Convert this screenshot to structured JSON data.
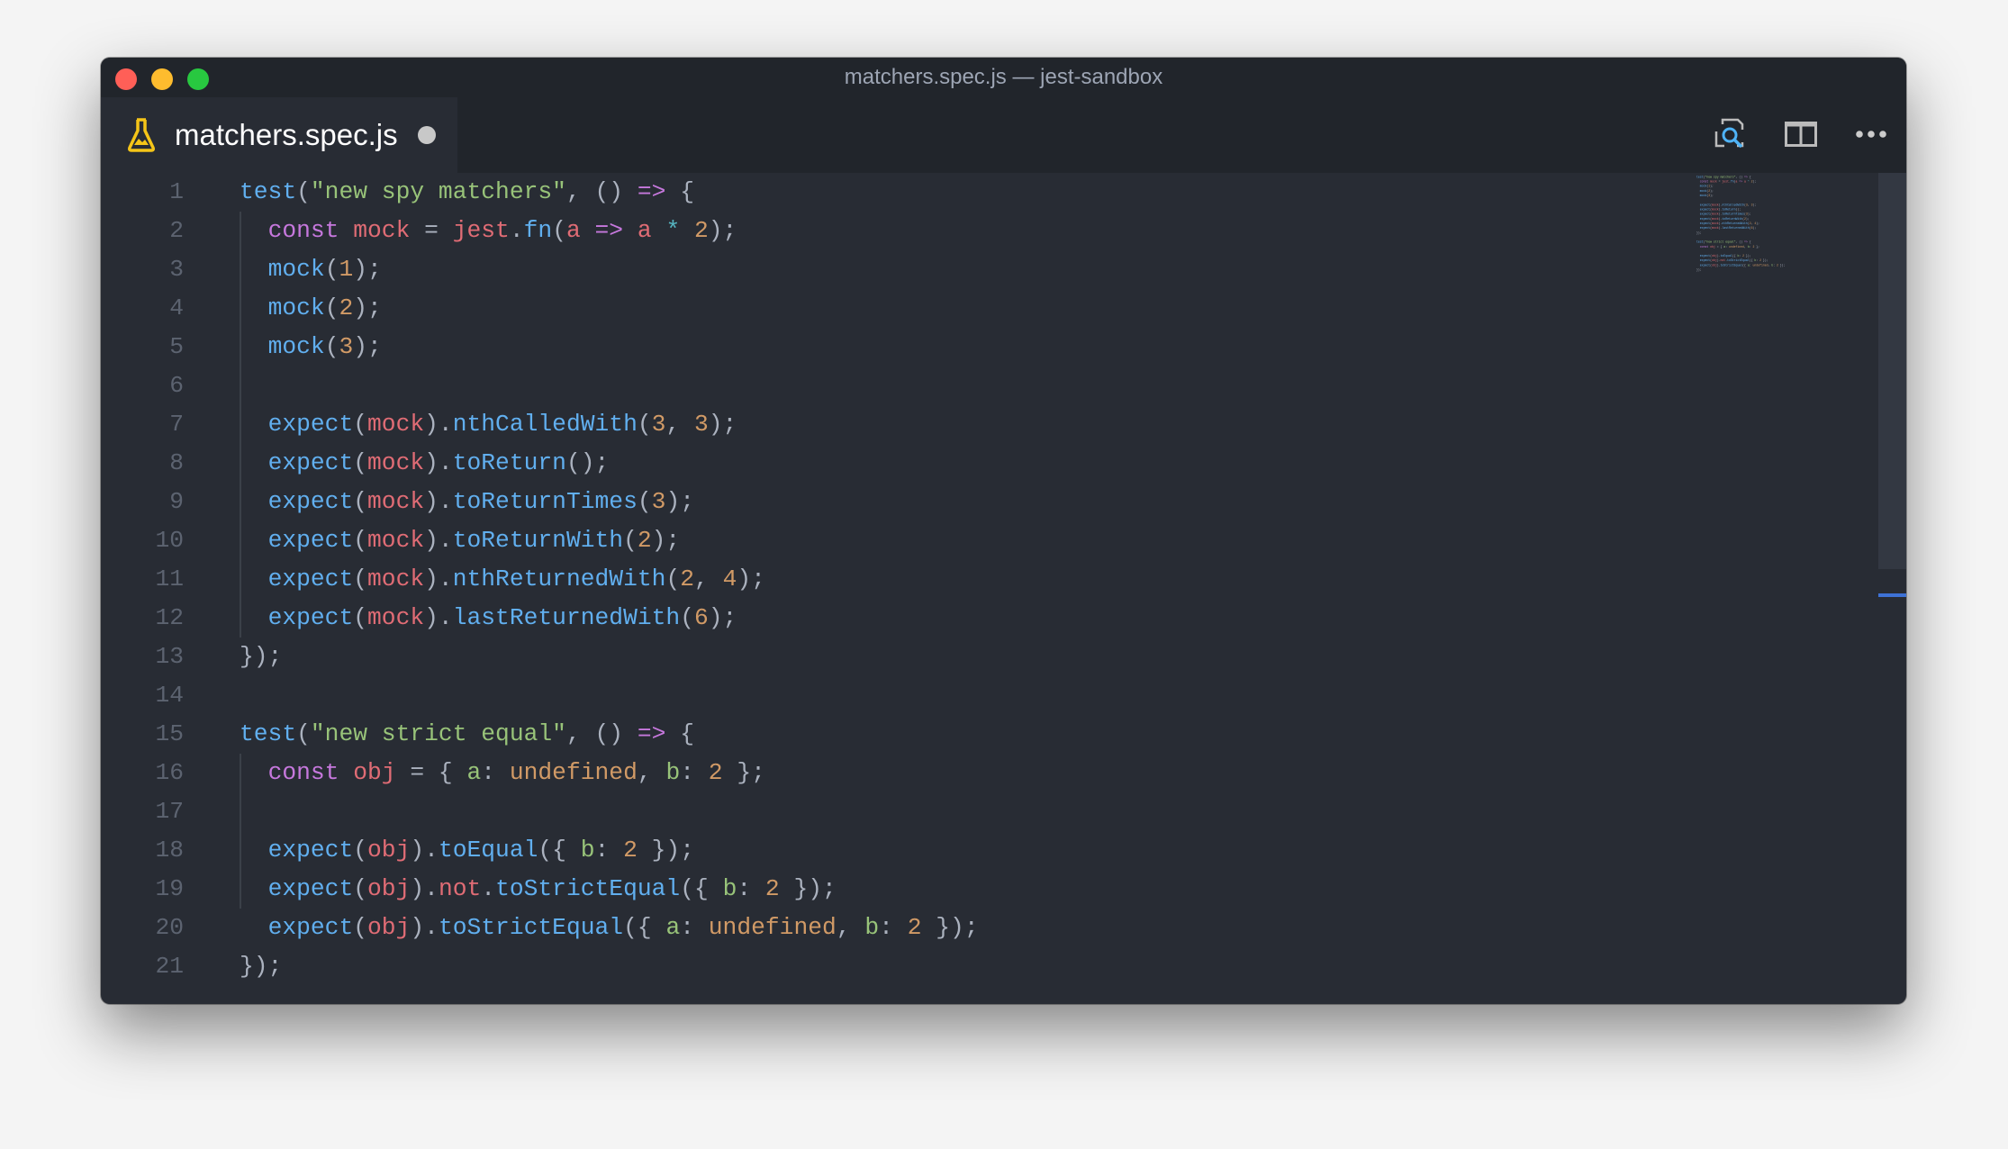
{
  "window": {
    "title": "matchers.spec.js — jest-sandbox",
    "traffic_lights": {
      "close": "#ff5f57",
      "minimize": "#febc2e",
      "zoom": "#28c840"
    }
  },
  "tab": {
    "label": "matchers.spec.js",
    "icon": "flask-icon",
    "icon_color": "#f5c518",
    "modified": true
  },
  "toolbar": {
    "icons": [
      "preview-search-icon",
      "split-editor-icon",
      "more-icon"
    ]
  },
  "theme": {
    "background": "#282c34",
    "keyword": "#c678dd",
    "variable": "#e06c75",
    "function": "#61afef",
    "string": "#98c379",
    "number": "#d19a66",
    "operator": "#56b6c2",
    "accent": "#3e72d6"
  },
  "editor": {
    "lines": [
      {
        "number": "1",
        "indent": 0,
        "tokens": [
          [
            "f",
            "test"
          ],
          [
            "p",
            "("
          ],
          [
            "s",
            "\"new spy matchers\""
          ],
          [
            "p",
            ", () "
          ],
          [
            "k",
            "=>"
          ],
          [
            "p",
            " {"
          ]
        ]
      },
      {
        "number": "2",
        "indent": 1,
        "tokens": [
          [
            "k",
            "const"
          ],
          [
            "p",
            " "
          ],
          [
            "v",
            "mock"
          ],
          [
            "p",
            " = "
          ],
          [
            "v",
            "jest"
          ],
          [
            "p",
            "."
          ],
          [
            "f",
            "fn"
          ],
          [
            "p",
            "("
          ],
          [
            "v",
            "a"
          ],
          [
            "p",
            " "
          ],
          [
            "k",
            "=>"
          ],
          [
            "p",
            " "
          ],
          [
            "v",
            "a"
          ],
          [
            "p",
            " "
          ],
          [
            "o",
            "*"
          ],
          [
            "p",
            " "
          ],
          [
            "n",
            "2"
          ],
          [
            "p",
            ");"
          ]
        ]
      },
      {
        "number": "3",
        "indent": 1,
        "tokens": [
          [
            "f",
            "mock"
          ],
          [
            "p",
            "("
          ],
          [
            "n",
            "1"
          ],
          [
            "p",
            ");"
          ]
        ]
      },
      {
        "number": "4",
        "indent": 1,
        "tokens": [
          [
            "f",
            "mock"
          ],
          [
            "p",
            "("
          ],
          [
            "n",
            "2"
          ],
          [
            "p",
            ");"
          ]
        ]
      },
      {
        "number": "5",
        "indent": 1,
        "tokens": [
          [
            "f",
            "mock"
          ],
          [
            "p",
            "("
          ],
          [
            "n",
            "3"
          ],
          [
            "p",
            ");"
          ]
        ]
      },
      {
        "number": "6",
        "indent": 1,
        "tokens": []
      },
      {
        "number": "7",
        "indent": 1,
        "tokens": [
          [
            "f",
            "expect"
          ],
          [
            "p",
            "("
          ],
          [
            "v",
            "mock"
          ],
          [
            "p",
            ")."
          ],
          [
            "f",
            "nthCalledWith"
          ],
          [
            "p",
            "("
          ],
          [
            "n",
            "3"
          ],
          [
            "p",
            ", "
          ],
          [
            "n",
            "3"
          ],
          [
            "p",
            ");"
          ]
        ]
      },
      {
        "number": "8",
        "indent": 1,
        "tokens": [
          [
            "f",
            "expect"
          ],
          [
            "p",
            "("
          ],
          [
            "v",
            "mock"
          ],
          [
            "p",
            ")."
          ],
          [
            "f",
            "toReturn"
          ],
          [
            "p",
            "();"
          ]
        ]
      },
      {
        "number": "9",
        "indent": 1,
        "tokens": [
          [
            "f",
            "expect"
          ],
          [
            "p",
            "("
          ],
          [
            "v",
            "mock"
          ],
          [
            "p",
            ")."
          ],
          [
            "f",
            "toReturnTimes"
          ],
          [
            "p",
            "("
          ],
          [
            "n",
            "3"
          ],
          [
            "p",
            ");"
          ]
        ]
      },
      {
        "number": "10",
        "indent": 1,
        "tokens": [
          [
            "f",
            "expect"
          ],
          [
            "p",
            "("
          ],
          [
            "v",
            "mock"
          ],
          [
            "p",
            ")."
          ],
          [
            "f",
            "toReturnWith"
          ],
          [
            "p",
            "("
          ],
          [
            "n",
            "2"
          ],
          [
            "p",
            ");"
          ]
        ]
      },
      {
        "number": "11",
        "indent": 1,
        "tokens": [
          [
            "f",
            "expect"
          ],
          [
            "p",
            "("
          ],
          [
            "v",
            "mock"
          ],
          [
            "p",
            ")."
          ],
          [
            "f",
            "nthReturnedWith"
          ],
          [
            "p",
            "("
          ],
          [
            "n",
            "2"
          ],
          [
            "p",
            ", "
          ],
          [
            "n",
            "4"
          ],
          [
            "p",
            ");"
          ]
        ]
      },
      {
        "number": "12",
        "indent": 1,
        "tokens": [
          [
            "f",
            "expect"
          ],
          [
            "p",
            "("
          ],
          [
            "v",
            "mock"
          ],
          [
            "p",
            ")."
          ],
          [
            "f",
            "lastReturnedWith"
          ],
          [
            "p",
            "("
          ],
          [
            "n",
            "6"
          ],
          [
            "p",
            ");"
          ]
        ]
      },
      {
        "number": "13",
        "indent": 0,
        "tokens": [
          [
            "p",
            "});"
          ]
        ]
      },
      {
        "number": "14",
        "indent": 0,
        "tokens": []
      },
      {
        "number": "15",
        "indent": 0,
        "tokens": [
          [
            "f",
            "test"
          ],
          [
            "p",
            "("
          ],
          [
            "s",
            "\"new strict equal\""
          ],
          [
            "p",
            ", () "
          ],
          [
            "k",
            "=>"
          ],
          [
            "p",
            " {"
          ]
        ]
      },
      {
        "number": "16",
        "indent": 1,
        "tokens": [
          [
            "k",
            "const"
          ],
          [
            "p",
            " "
          ],
          [
            "v",
            "obj"
          ],
          [
            "p",
            " = { "
          ],
          [
            "s",
            "a"
          ],
          [
            "p",
            ": "
          ],
          [
            "n",
            "undefined"
          ],
          [
            "p",
            ", "
          ],
          [
            "s",
            "b"
          ],
          [
            "p",
            ": "
          ],
          [
            "n",
            "2"
          ],
          [
            "p",
            " };"
          ]
        ]
      },
      {
        "number": "17",
        "indent": 1,
        "tokens": []
      },
      {
        "number": "18",
        "indent": 1,
        "tokens": [
          [
            "f",
            "expect"
          ],
          [
            "p",
            "("
          ],
          [
            "v",
            "obj"
          ],
          [
            "p",
            ")."
          ],
          [
            "f",
            "toEqual"
          ],
          [
            "p",
            "({ "
          ],
          [
            "s",
            "b"
          ],
          [
            "p",
            ": "
          ],
          [
            "n",
            "2"
          ],
          [
            "p",
            " });"
          ]
        ]
      },
      {
        "number": "19",
        "indent": 1,
        "tokens": [
          [
            "f",
            "expect"
          ],
          [
            "p",
            "("
          ],
          [
            "v",
            "obj"
          ],
          [
            "p",
            ")."
          ],
          [
            "v",
            "not"
          ],
          [
            "p",
            "."
          ],
          [
            "f",
            "toStrictEqual"
          ],
          [
            "p",
            "({ "
          ],
          [
            "s",
            "b"
          ],
          [
            "p",
            ": "
          ],
          [
            "n",
            "2"
          ],
          [
            "p",
            " });"
          ]
        ]
      },
      {
        "number": "20",
        "indent": 1,
        "tokens": [
          [
            "f",
            "expect"
          ],
          [
            "p",
            "("
          ],
          [
            "v",
            "obj"
          ],
          [
            "p",
            ")."
          ],
          [
            "f",
            "toStrictEqual"
          ],
          [
            "p",
            "({ "
          ],
          [
            "s",
            "a"
          ],
          [
            "p",
            ": "
          ],
          [
            "n",
            "undefined"
          ],
          [
            "p",
            ", "
          ],
          [
            "s",
            "b"
          ],
          [
            "p",
            ": "
          ],
          [
            "n",
            "2"
          ],
          [
            "p",
            " });"
          ]
        ]
      },
      {
        "number": "21",
        "indent": 0,
        "tokens": [
          [
            "p",
            "});"
          ]
        ]
      }
    ]
  }
}
